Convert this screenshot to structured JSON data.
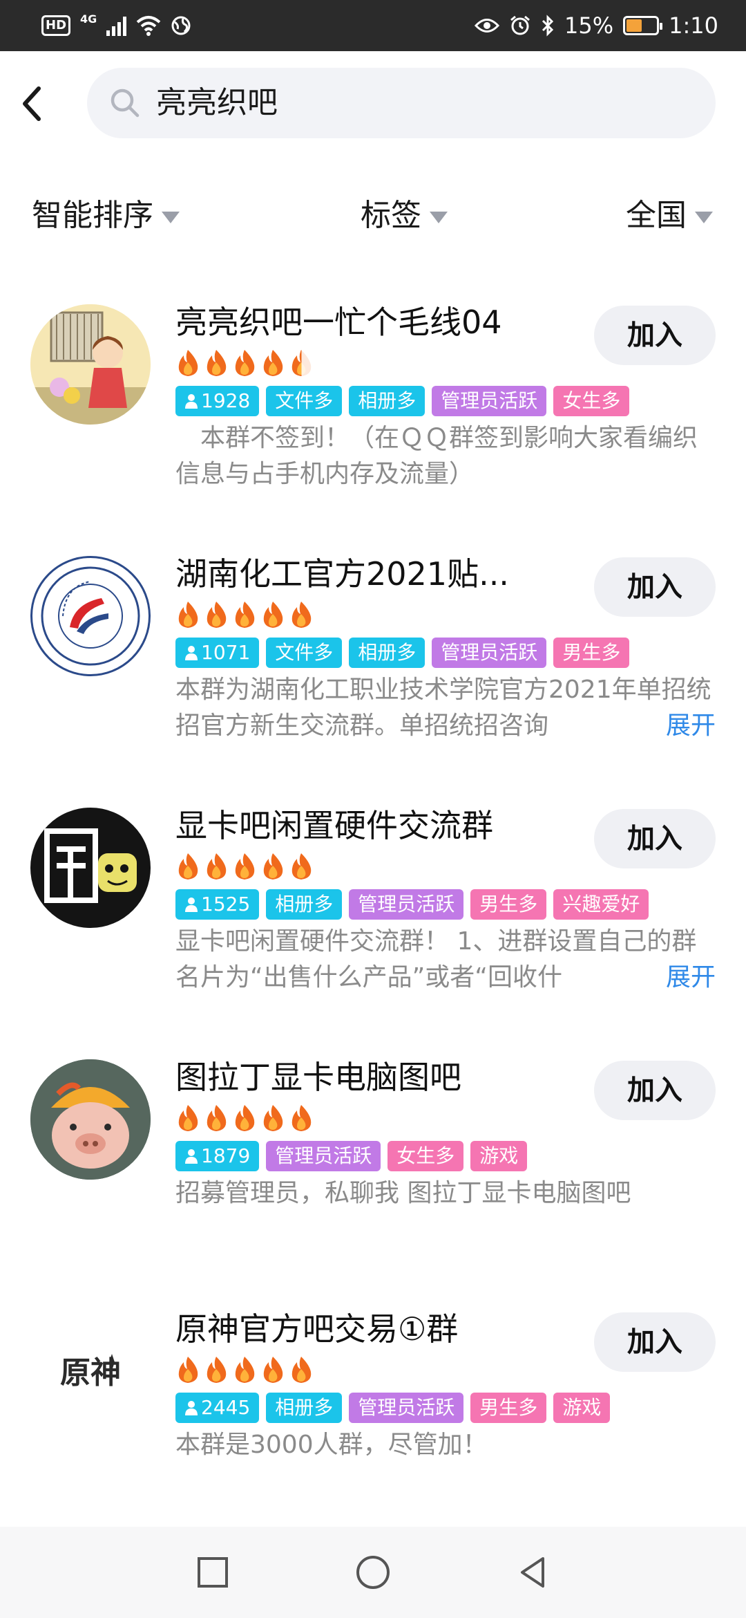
{
  "status_bar": {
    "hd": "HD",
    "network": "4G",
    "battery": "15%",
    "time": "1:10"
  },
  "search": {
    "query": "亮亮织吧"
  },
  "filters": [
    {
      "label": "智能排序"
    },
    {
      "label": "标签"
    },
    {
      "label": "全国"
    }
  ],
  "join_label": "加入",
  "expand_label": "展开",
  "groups": [
    {
      "name": "亮亮织吧一忙个毛线04",
      "heat": 4.5,
      "members": "1928",
      "tags": [
        "文件多",
        "相册多",
        "管理员活跃",
        "女生多"
      ],
      "desc": "　本群不签到！（在ＱＱ群签到影响大家看编织信息与占手机内存及流量）"
    },
    {
      "name": "湖南化工官方2021贴...",
      "heat": 5,
      "members": "1071",
      "tags": [
        "文件多",
        "相册多",
        "管理员活跃",
        "男生多"
      ],
      "desc": "本群为湖南化工职业技术学院官方2021年单招统招官方新生交流群。单招统招咨询"
    },
    {
      "name": "显卡吧闲置硬件交流群",
      "heat": 5,
      "members": "1525",
      "tags": [
        "相册多",
        "管理员活跃",
        "男生多",
        "兴趣爱好"
      ],
      "desc": "显卡吧闲置硬件交流群！ 1、进群设置自己的群名片为“出售什么产品”或者“回收什"
    },
    {
      "name": "图拉丁显卡电脑图吧",
      "heat": 5,
      "members": "1879",
      "tags": [
        "管理员活跃",
        "女生多",
        "游戏"
      ],
      "desc": "招募管理员，私聊我 图拉丁显卡电脑图吧"
    },
    {
      "name": "原神官方吧交易①群",
      "heat": 5,
      "members": "2445",
      "tags": [
        "相册多",
        "管理员活跃",
        "男生多",
        "游戏"
      ],
      "desc": "本群是3000人群，尽管加！"
    }
  ],
  "icons": {
    "back": "back-arrow-icon",
    "search": "search-icon",
    "dropdown": "triangle-down-icon",
    "fire": "fire-icon",
    "member": "person-icon",
    "nav_recents": "square-icon",
    "nav_home": "circle-icon",
    "nav_back": "triangle-back-icon"
  },
  "colors": {
    "tag_cyan": "#1bc4ea",
    "tag_purple": "#c17ae6",
    "tag_pink": "#f575b2",
    "link_blue": "#2f89e8",
    "fire_orange": "#f06a1c",
    "battery_fill": "#f4a23a"
  },
  "logo_text": "原神"
}
